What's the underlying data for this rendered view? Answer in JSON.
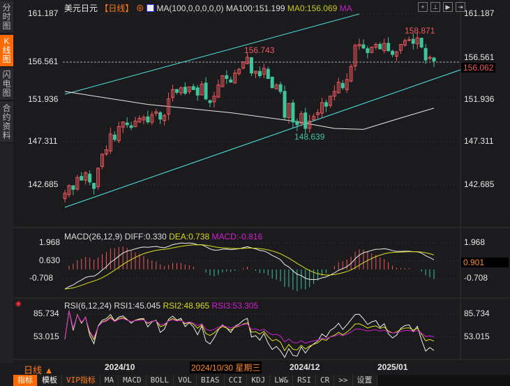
{
  "sidebar": {
    "tabs": [
      "分时图",
      "K线图",
      "闪电图",
      "合约资料"
    ],
    "active": 1
  },
  "header": {
    "symbol": "美元日元",
    "period": "【日线】",
    "ma_formula": "MA(100,0,0,0,0,0)",
    "ma100": "MA100:151.199",
    "ma0": "MA0:156.069",
    "ma": "MA"
  },
  "toolbar_icons": [
    "crosshair-icon",
    "zoom-in-icon",
    "play-icon",
    "move-right-icon"
  ],
  "price_axis": {
    "labels": [
      "161.187",
      "156.561",
      "151.936",
      "147.311",
      "142.685"
    ],
    "current": "156.062"
  },
  "annotations": {
    "high1": "156.743",
    "high2": "158.871",
    "low": "148.639"
  },
  "macd": {
    "title": "MACD(26,12,9)",
    "diff": "DIFF:0.330",
    "dea": "DEA:0.738",
    "macd": "MACD:-0.816",
    "axis": [
      "1.968",
      "0.630",
      "-0.708"
    ],
    "current": "0.901"
  },
  "rsi": {
    "title": "RSI(6,12,24)",
    "rsi1": "RSI1:45.045",
    "rsi2": "RSI2:48.965",
    "rsi3": "RSI3:53.305",
    "axis": [
      "85.734",
      "53.015"
    ]
  },
  "time_axis": {
    "period": "日线",
    "labels": [
      "2024/10",
      "2024/12",
      "2025/01"
    ],
    "cursor": "2024/10/30 星期三"
  },
  "bottom_tabs": [
    "指标",
    "模板",
    "VIP指标",
    "MA",
    "MACD",
    "BOLL",
    "VOL",
    "BIAS",
    "CCI",
    "KDJ",
    "LW&",
    "RSI",
    "CR",
    ">>",
    "设置"
  ],
  "colors": {
    "up": "#f0585d",
    "down": "#3fc59a",
    "accent": "#ff6a00",
    "ma100": "#e8e8e8",
    "channel": "#4fe6e6"
  },
  "chart_data": {
    "type": "candlestick",
    "ylim": [
      140.5,
      162.5
    ],
    "closes": [
      141.8,
      142.6,
      142.2,
      143.5,
      143.2,
      144.0,
      143.0,
      142.3,
      144.5,
      146.0,
      146.5,
      148.2,
      147.6,
      149.0,
      149.5,
      149.2,
      148.9,
      149.6,
      149.9,
      150.0,
      149.5,
      150.3,
      150.6,
      149.8,
      150.2,
      152.0,
      153.0,
      152.7,
      153.2,
      152.6,
      153.3,
      153.0,
      152.4,
      153.6,
      152.0,
      151.6,
      152.3,
      153.5,
      154.5,
      154.2,
      153.8,
      154.8,
      155.2,
      156.0,
      156.5,
      154.8,
      155.0,
      154.5,
      155.3,
      154.2,
      153.2,
      153.5,
      152.8,
      150.0,
      151.5,
      149.5,
      149.2,
      150.4,
      148.8,
      149.6,
      150.1,
      150.5,
      151.6,
      151.2,
      152.3,
      152.8,
      153.8,
      153.2,
      154.1,
      155.5,
      157.8,
      157.9,
      157.5,
      157.0,
      157.6,
      157.9,
      157.4,
      158.0,
      157.2,
      156.8,
      157.1,
      157.9,
      158.3,
      158.4,
      158.0,
      158.6,
      157.6,
      156.2,
      156.5,
      156.1
    ],
    "ma100": [
      [
        0,
        152.8
      ],
      [
        20,
        151.4
      ],
      [
        40,
        150.5
      ],
      [
        55,
        149.6
      ],
      [
        65,
        148.8
      ],
      [
        72,
        148.7
      ],
      [
        80,
        149.8
      ],
      [
        89,
        151.0
      ]
    ]
  }
}
